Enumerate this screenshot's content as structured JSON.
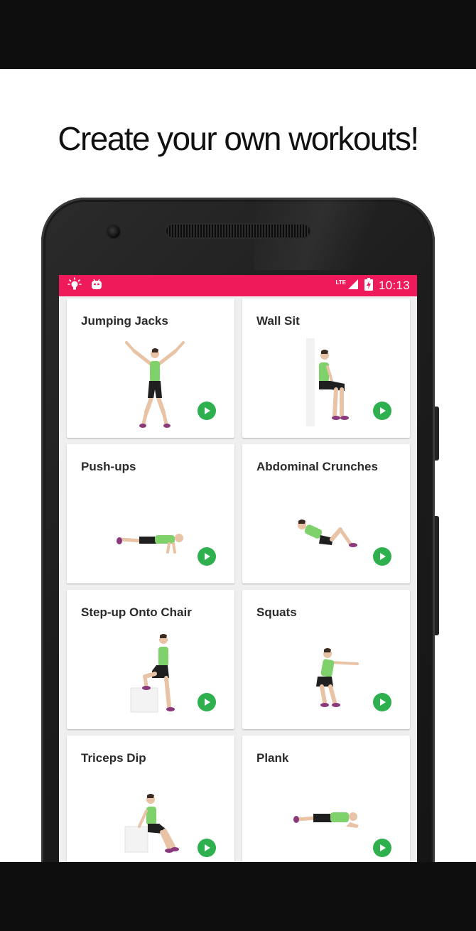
{
  "headline": "Create your own workouts!",
  "status_bar": {
    "network": "LTE",
    "time": "10:13",
    "left_icons": [
      "lightbulb-icon",
      "android-icon"
    ],
    "right_icons": [
      "signal-icon",
      "battery-charging-icon"
    ]
  },
  "colors": {
    "accent": "#ef1a5a",
    "play": "#2fb04f",
    "shirt": "#7fd26b"
  },
  "exercises": [
    {
      "title": "Jumping Jacks",
      "pose": "jumping-jacks"
    },
    {
      "title": "Wall Sit",
      "pose": "wall-sit"
    },
    {
      "title": "Push-ups",
      "pose": "push-up"
    },
    {
      "title": "Abdominal Crunches",
      "pose": "crunch"
    },
    {
      "title": "Step-up Onto Chair",
      "pose": "step-up"
    },
    {
      "title": "Squats",
      "pose": "squat"
    },
    {
      "title": "Triceps Dip",
      "pose": "triceps-dip"
    },
    {
      "title": "Plank",
      "pose": "plank"
    }
  ]
}
